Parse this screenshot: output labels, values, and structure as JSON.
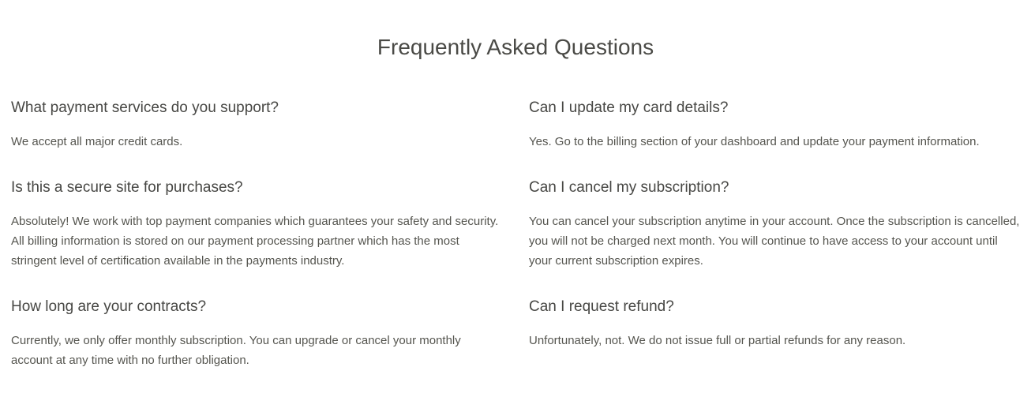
{
  "faq": {
    "title": "Frequently Asked Questions",
    "items": [
      {
        "question": "What payment services do you support?",
        "answer": "We accept all major credit cards."
      },
      {
        "question": "Can I update my card details?",
        "answer": "Yes. Go to the billing section of your dashboard and update your payment information."
      },
      {
        "question": "Is this a secure site for purchases?",
        "answer": "Absolutely! We work with top payment companies which guarantees your safety and security. All billing information is stored on our payment processing partner which has the most stringent level of certification available in the payments industry."
      },
      {
        "question": "Can I cancel my subscription?",
        "answer": "You can cancel your subscription anytime in your account. Once the subscription is cancelled, you will not be charged next month. You will continue to have access to your account until your current subscription expires."
      },
      {
        "question": "How long are your contracts?",
        "answer": "Currently, we only offer monthly subscription. You can upgrade or cancel your monthly account at any time with no further obligation."
      },
      {
        "question": "Can I request refund?",
        "answer": "Unfortunately, not. We do not issue full or partial refunds for any reason."
      }
    ]
  }
}
